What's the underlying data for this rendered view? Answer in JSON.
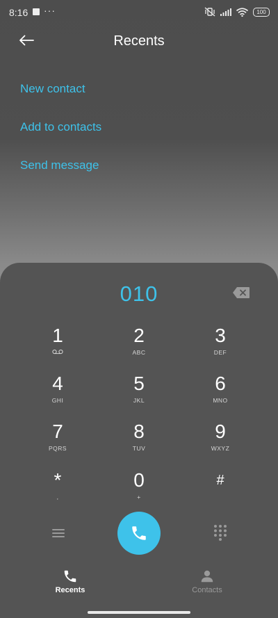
{
  "status_bar": {
    "time": "8:16",
    "more": "···",
    "battery": "100"
  },
  "header": {
    "title": "Recents"
  },
  "options": [
    {
      "label": "New contact"
    },
    {
      "label": "Add to contacts"
    },
    {
      "label": "Send message"
    }
  ],
  "dialer": {
    "number": "010",
    "keys": [
      {
        "digit": "1",
        "letters": ""
      },
      {
        "digit": "2",
        "letters": "ABC"
      },
      {
        "digit": "3",
        "letters": "DEF"
      },
      {
        "digit": "4",
        "letters": "GHI"
      },
      {
        "digit": "5",
        "letters": "JKL"
      },
      {
        "digit": "6",
        "letters": "MNO"
      },
      {
        "digit": "7",
        "letters": "PQRS"
      },
      {
        "digit": "8",
        "letters": "TUV"
      },
      {
        "digit": "9",
        "letters": "WXYZ"
      },
      {
        "digit": "*",
        "letters": ","
      },
      {
        "digit": "0",
        "letters": "+"
      },
      {
        "digit": "#",
        "letters": ""
      }
    ]
  },
  "nav": {
    "recents": "Recents",
    "contacts": "Contacts"
  },
  "colors": {
    "accent": "#3ec2ea",
    "sheet": "#545454",
    "active_tab": "#ffffff",
    "inactive_tab": "#9a9a9a"
  }
}
